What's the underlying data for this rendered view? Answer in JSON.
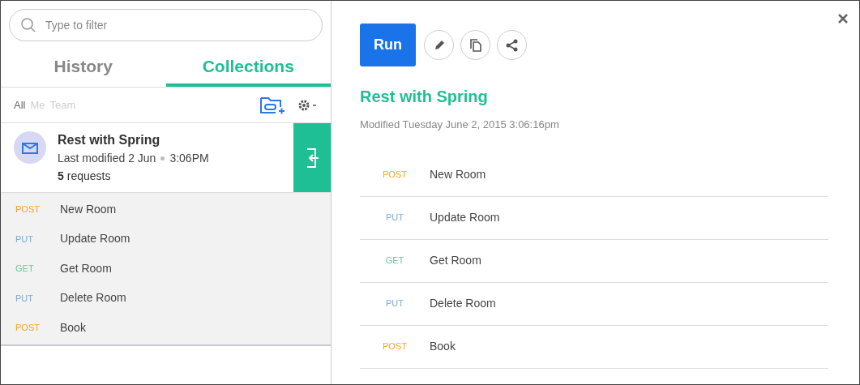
{
  "search": {
    "placeholder": "Type to filter"
  },
  "tabs": [
    {
      "label": "History",
      "selected": false
    },
    {
      "label": "Collections",
      "selected": true
    }
  ],
  "filters": [
    {
      "label": "All",
      "selected": true
    },
    {
      "label": "Me",
      "selected": false
    },
    {
      "label": "Team",
      "selected": false
    }
  ],
  "collection": {
    "name": "Rest with Spring",
    "modified": "Last modified 2 Jun",
    "time": "3:06PM",
    "count": "5",
    "count_label": "requests",
    "requests": [
      {
        "method": "POST",
        "color": "#f5a623",
        "name": "New Room"
      },
      {
        "method": "PUT",
        "color": "#7fa8d8",
        "name": "Update Room"
      },
      {
        "method": "GET",
        "color": "#6cc79a",
        "name": "Get Room"
      },
      {
        "method": "PUT",
        "color": "#7fa8d8",
        "name": "Delete Room"
      },
      {
        "method": "POST",
        "color": "#f5a623",
        "name": "Book"
      }
    ]
  },
  "detail": {
    "run_label": "Run",
    "title": "Rest with Spring",
    "modified": "Modified Tuesday June 2, 2015 3:06:16pm",
    "requests": [
      {
        "method": "POST",
        "color": "#f5a623",
        "name": "New Room"
      },
      {
        "method": "PUT",
        "color": "#7fa8d8",
        "name": "Update Room"
      },
      {
        "method": "GET",
        "color": "#6cc79a",
        "name": "Get Room"
      },
      {
        "method": "PUT",
        "color": "#7fa8d8",
        "name": "Delete Room"
      },
      {
        "method": "POST",
        "color": "#f5a623",
        "name": "Book"
      }
    ]
  }
}
